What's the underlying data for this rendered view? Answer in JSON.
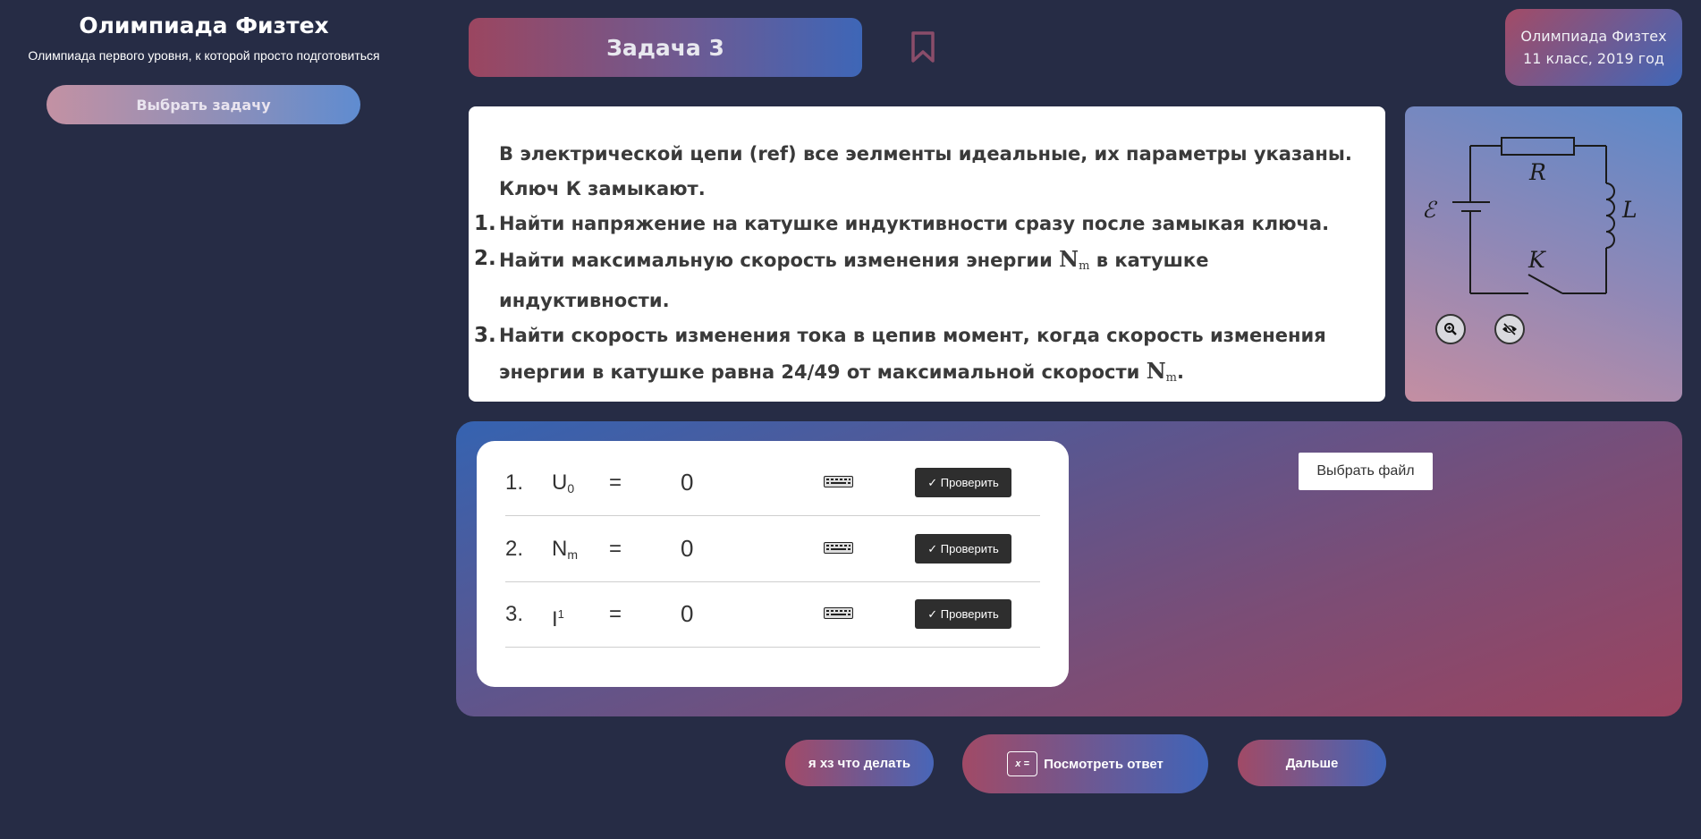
{
  "sidebar": {
    "title": "Олимпиада Физтех",
    "subtitle": "Олимпиада первого уровня, к которой просто подготовиться",
    "choose_task": "Выбрать задачу"
  },
  "header": {
    "task_title": "Задача 3",
    "badge_line1": "Олимпиада Физтех",
    "badge_line2": "11 класс, 2019 год"
  },
  "problem": {
    "intro": "В электрической цепи (ref) все эелменты идеальные, их параметры указаны. Ключ К замыкают.",
    "items": [
      {
        "num": "1.",
        "pre": "Найти напряжение на катушке индуктивности сразу после замыкая ключа.",
        "sym": "",
        "post": ""
      },
      {
        "num": "2.",
        "pre": "Найти максимальную скорость изменения энергии ",
        "sym": "N",
        "sub": "m",
        "post": " в катушке индуктивности."
      },
      {
        "num": "3.",
        "pre": "Найти скорость изменения тока в цепив момент, когда скорость изменения энергии в катушке равна 24/49 от максимальной скорости ",
        "sym": "N",
        "sub": "m",
        "post": "."
      }
    ]
  },
  "diagram": {
    "labels": {
      "R": "R",
      "L": "L",
      "K": "K",
      "E": "ℰ"
    },
    "zoom_icon": "zoom-in-icon",
    "hide_icon": "eye-off-icon"
  },
  "answers": [
    {
      "num": "1.",
      "sym": "U",
      "sub": "0",
      "sup": "",
      "eq": "=",
      "value": "0",
      "check": "✓ Проверить"
    },
    {
      "num": "2.",
      "sym": "N",
      "sub": "m",
      "sup": "",
      "eq": "=",
      "value": "0",
      "check": "✓ Проверить"
    },
    {
      "num": "3.",
      "sym": "I",
      "sub": "",
      "sup": "1",
      "eq": "=",
      "value": "0",
      "check": "✓ Проверить"
    }
  ],
  "file_button": "Выбрать файл",
  "bottom": {
    "dont_know": "я хз что делать",
    "show_answer": "Посмотреть ответ",
    "show_answer_icon": "x =",
    "next": "Дальше"
  },
  "colors": {
    "background": "#262c45",
    "gradient_pink": "#a34b66",
    "gradient_blue": "#3f67b8"
  }
}
